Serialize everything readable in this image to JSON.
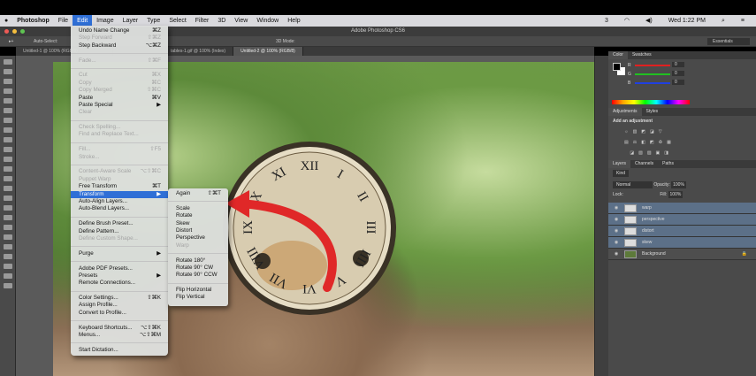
{
  "menubar": {
    "apple": "",
    "app": "Photoshop",
    "items": [
      "File",
      "Edit",
      "Image",
      "Layer",
      "Type",
      "Select",
      "Filter",
      "3D",
      "View",
      "Window",
      "Help"
    ],
    "active": "Edit",
    "status": {
      "adobe": "3",
      "clock": "Wed 1:22 PM"
    }
  },
  "window_title": "Adobe Photoshop CS6",
  "options": {
    "auto_select": "Auto-Select:",
    "mode_3d": "3D Mode:",
    "workspace": "Essentials"
  },
  "tabs": [
    "Untitled-1 @ 100% (RGB/8)",
    "tables-1.gif @ 100% (Index)",
    "Untitled-2 @ 100% (RGB/8)"
  ],
  "edit_menu": [
    {
      "label": "Undo Name Change",
      "shortcut": "⌘Z"
    },
    {
      "label": "Step Forward",
      "shortcut": "⇧⌘Z",
      "disabled": true
    },
    {
      "label": "Step Backward",
      "shortcut": "⌥⌘Z"
    },
    {
      "sep": true
    },
    {
      "label": "Fade...",
      "shortcut": "⇧⌘F",
      "disabled": true
    },
    {
      "sep": true
    },
    {
      "label": "Cut",
      "shortcut": "⌘X",
      "disabled": true
    },
    {
      "label": "Copy",
      "shortcut": "⌘C",
      "disabled": true
    },
    {
      "label": "Copy Merged",
      "shortcut": "⇧⌘C",
      "disabled": true
    },
    {
      "label": "Paste",
      "shortcut": "⌘V"
    },
    {
      "label": "Paste Special",
      "shortcut": "▶"
    },
    {
      "label": "Clear",
      "shortcut": "",
      "disabled": true
    },
    {
      "sep": true
    },
    {
      "label": "Check Spelling...",
      "shortcut": "",
      "disabled": true
    },
    {
      "label": "Find and Replace Text...",
      "shortcut": "",
      "disabled": true
    },
    {
      "sep": true
    },
    {
      "label": "Fill...",
      "shortcut": "⇧F5",
      "disabled": true
    },
    {
      "label": "Stroke...",
      "shortcut": "",
      "disabled": true
    },
    {
      "sep": true
    },
    {
      "label": "Content-Aware Scale",
      "shortcut": "⌥⇧⌘C",
      "disabled": true
    },
    {
      "label": "Puppet Warp",
      "shortcut": "",
      "disabled": true
    },
    {
      "label": "Free Transform",
      "shortcut": "⌘T"
    },
    {
      "label": "Transform",
      "shortcut": "▶",
      "highlighted": true
    },
    {
      "label": "Auto-Align Layers...",
      "shortcut": ""
    },
    {
      "label": "Auto-Blend Layers...",
      "shortcut": ""
    },
    {
      "sep": true
    },
    {
      "label": "Define Brush Preset...",
      "shortcut": ""
    },
    {
      "label": "Define Pattern...",
      "shortcut": ""
    },
    {
      "label": "Define Custom Shape...",
      "shortcut": "",
      "disabled": true
    },
    {
      "sep": true
    },
    {
      "label": "Purge",
      "shortcut": "▶"
    },
    {
      "sep": true
    },
    {
      "label": "Adobe PDF Presets...",
      "shortcut": ""
    },
    {
      "label": "Presets",
      "shortcut": "▶"
    },
    {
      "label": "Remote Connections...",
      "shortcut": ""
    },
    {
      "sep": true
    },
    {
      "label": "Color Settings...",
      "shortcut": "⇧⌘K"
    },
    {
      "label": "Assign Profile...",
      "shortcut": ""
    },
    {
      "label": "Convert to Profile...",
      "shortcut": ""
    },
    {
      "sep": true
    },
    {
      "label": "Keyboard Shortcuts...",
      "shortcut": "⌥⇧⌘K"
    },
    {
      "label": "Menus...",
      "shortcut": "⌥⇧⌘M"
    },
    {
      "sep": true
    },
    {
      "label": "Start Dictation...",
      "shortcut": ""
    }
  ],
  "transform_menu": [
    {
      "label": "Again",
      "shortcut": "⇧⌘T"
    },
    {
      "sep": true
    },
    {
      "label": "Scale",
      "shortcut": ""
    },
    {
      "label": "Rotate",
      "shortcut": ""
    },
    {
      "label": "Skew",
      "shortcut": ""
    },
    {
      "label": "Distort",
      "shortcut": ""
    },
    {
      "label": "Perspective",
      "shortcut": ""
    },
    {
      "label": "Warp",
      "shortcut": "",
      "disabled": true
    },
    {
      "sep": true
    },
    {
      "label": "Rotate 180°",
      "shortcut": ""
    },
    {
      "label": "Rotate 90° CW",
      "shortcut": ""
    },
    {
      "label": "Rotate 90° CCW",
      "shortcut": ""
    },
    {
      "sep": true
    },
    {
      "label": "Flip Horizontal",
      "shortcut": ""
    },
    {
      "label": "Flip Vertical",
      "shortcut": ""
    }
  ],
  "color_panel": {
    "tabs": [
      "Color",
      "Swatches"
    ],
    "channels": [
      {
        "label": "R",
        "value": "0",
        "color": "#e02020"
      },
      {
        "label": "G",
        "value": "0",
        "color": "#20c020"
      },
      {
        "label": "B",
        "value": "0",
        "color": "#2040e0"
      }
    ]
  },
  "adjust_panel": {
    "tabs": [
      "Adjustments",
      "Styles"
    ],
    "heading": "Add an adjustment"
  },
  "layers_panel": {
    "tabs": [
      "Layers",
      "Channels",
      "Paths"
    ],
    "kind": "Kind",
    "blend": "Normal",
    "opacity_label": "Opacity:",
    "opacity": "100%",
    "lock_label": "Lock:",
    "fill_label": "Fill:",
    "fill": "100%",
    "layers": [
      {
        "name": "warp",
        "selected": true
      },
      {
        "name": "perspective",
        "selected": true
      },
      {
        "name": "distort",
        "selected": true
      },
      {
        "name": "skew",
        "selected": true
      },
      {
        "name": "Background",
        "selected": false
      }
    ]
  },
  "clock_numerals": [
    "XII",
    "I",
    "II",
    "III",
    "IIII",
    "V",
    "VI",
    "VII",
    "VIII",
    "IX",
    "X",
    "XI"
  ]
}
